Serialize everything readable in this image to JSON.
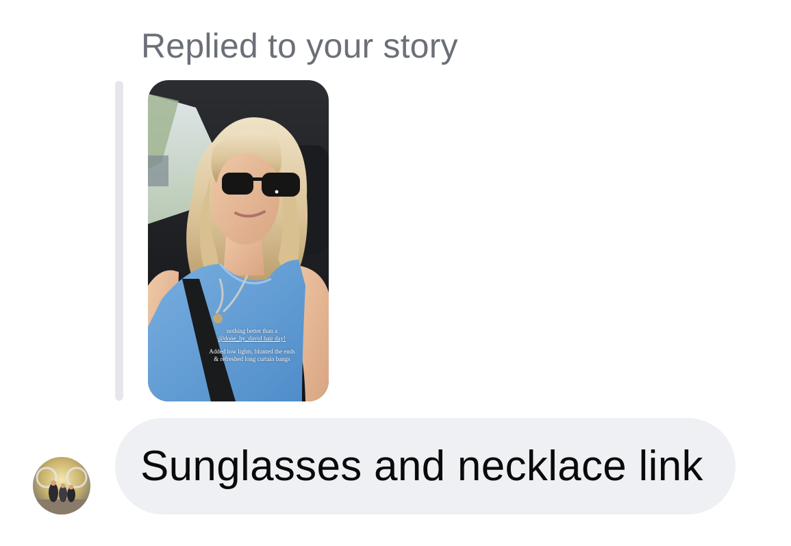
{
  "reply": {
    "header": "Replied to your story"
  },
  "story": {
    "image": "story-photo-selfie-in-car",
    "caption_lines_1": [
      "nothing better than a",
      "@done_by_david hair day!"
    ],
    "caption_lines_2": [
      "Added low lights, blunted the ends",
      "& refreshed long curtain bangs"
    ]
  },
  "message": {
    "avatar": "profile-photo-group",
    "text": "Sunglasses and necklace link"
  },
  "colors": {
    "header_text": "#6b6f78",
    "bubble_bg": "#eff0f4",
    "quote_bar": "#e6e7eb",
    "message_text": "#0a0a0a"
  }
}
